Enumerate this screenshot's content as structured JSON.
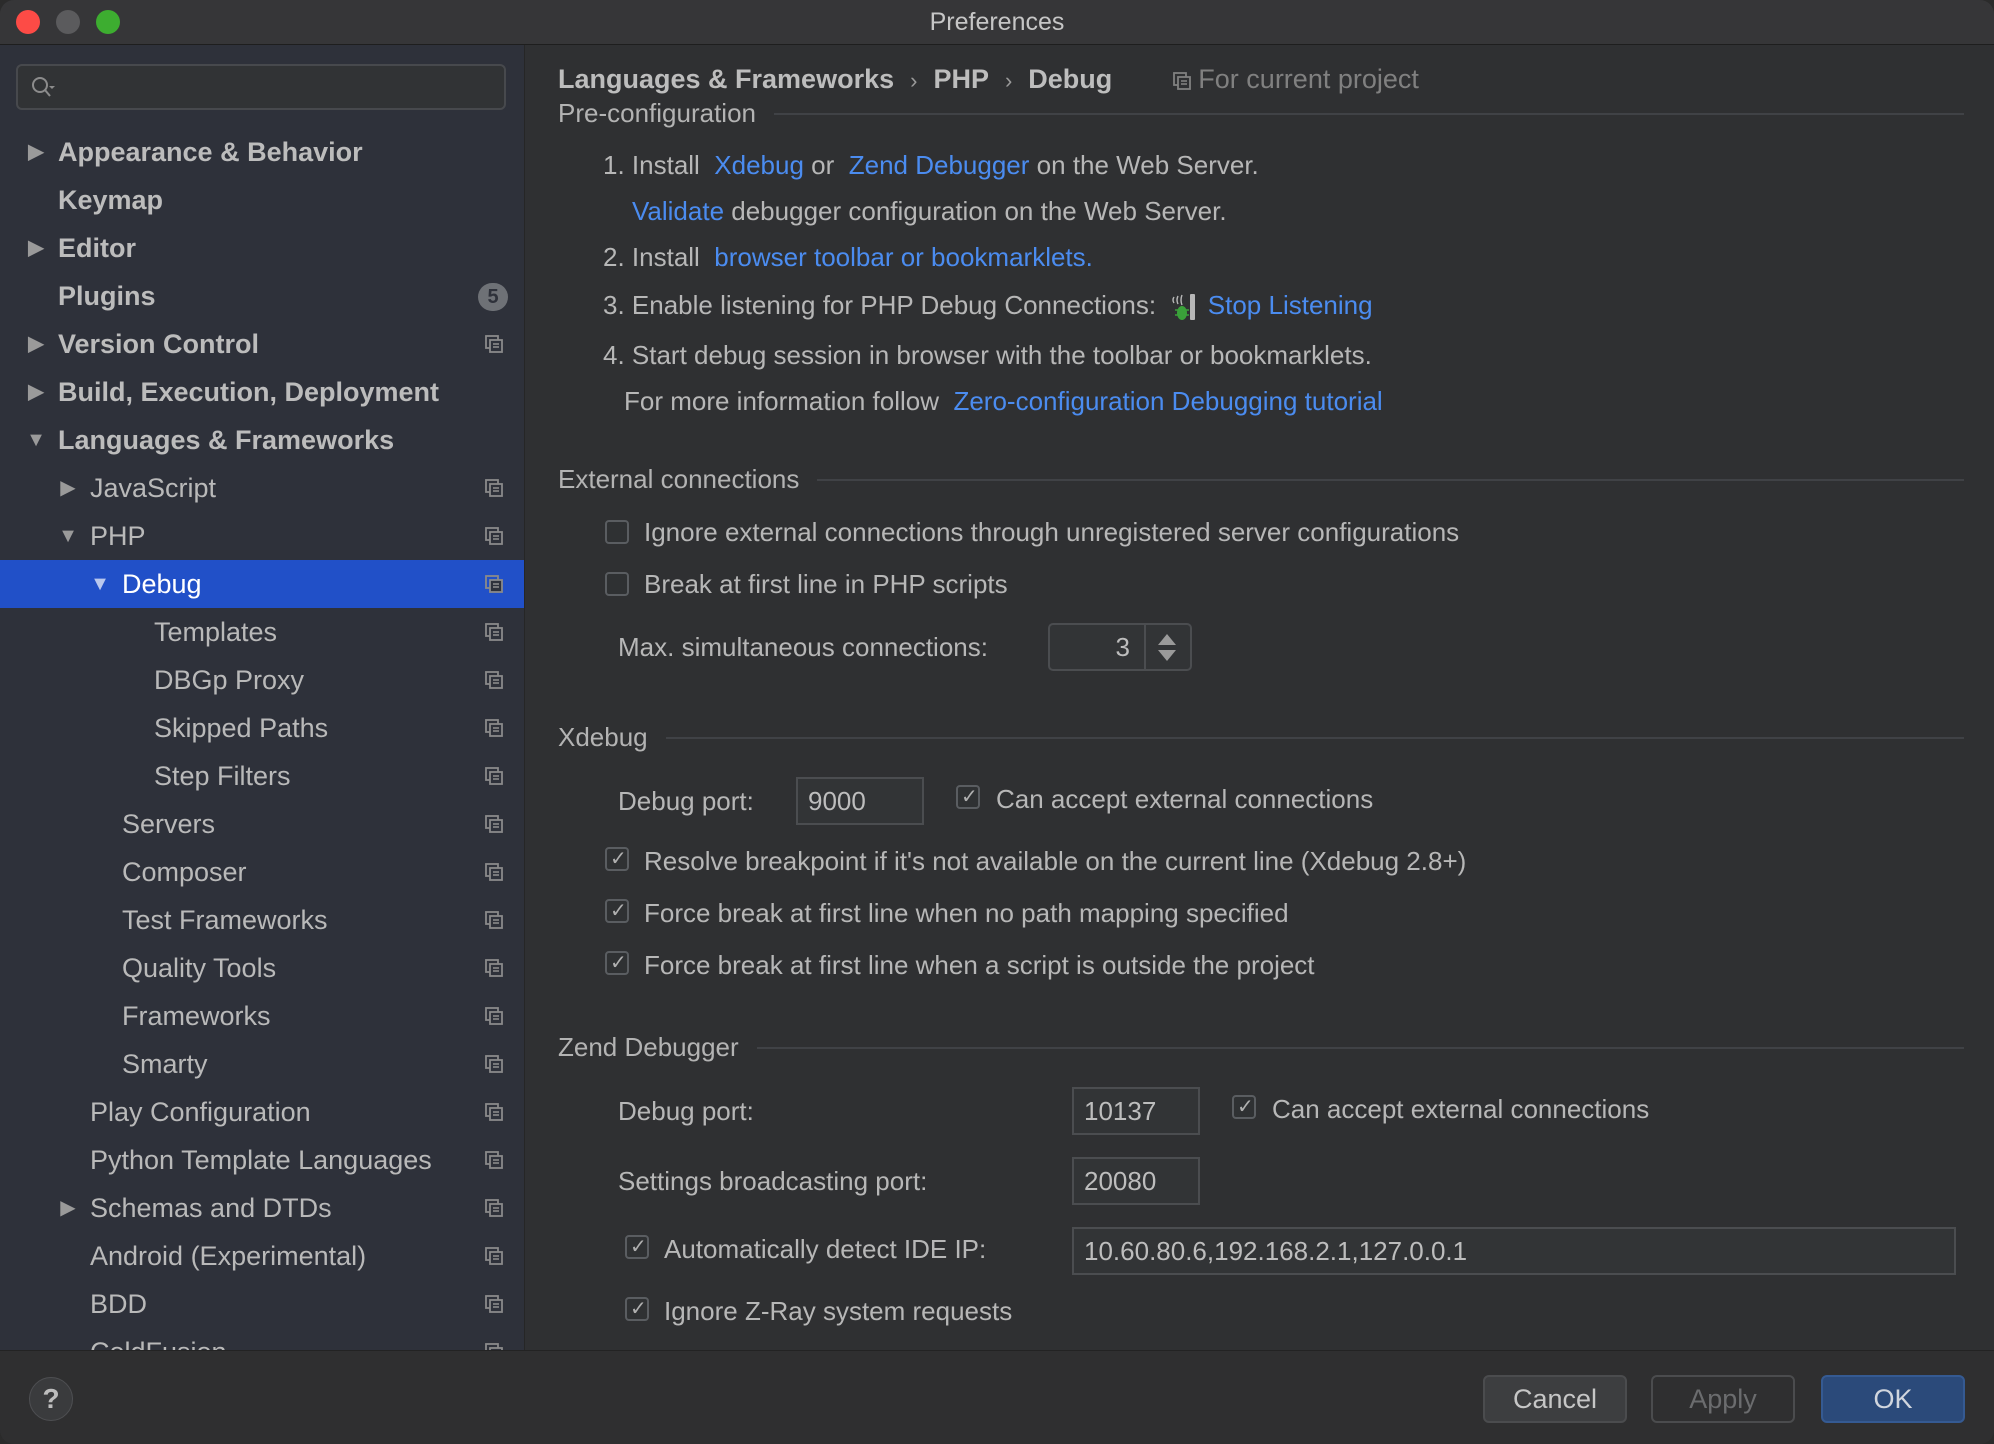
{
  "window": {
    "title": "Preferences"
  },
  "sidebar": {
    "search": {
      "placeholder": "",
      "value": ""
    },
    "items": [
      {
        "label": "Appearance & Behavior",
        "level": 0,
        "bold": true,
        "arrow": "right"
      },
      {
        "label": "Keymap",
        "level": 0,
        "bold": true,
        "arrow": ""
      },
      {
        "label": "Editor",
        "level": 0,
        "bold": true,
        "arrow": "right"
      },
      {
        "label": "Plugins",
        "level": 0,
        "bold": true,
        "arrow": "",
        "badge": "5"
      },
      {
        "label": "Version Control",
        "level": 0,
        "bold": true,
        "arrow": "right",
        "project": true
      },
      {
        "label": "Build, Execution, Deployment",
        "level": 0,
        "bold": true,
        "arrow": "right"
      },
      {
        "label": "Languages & Frameworks",
        "level": 0,
        "bold": true,
        "arrow": "down"
      },
      {
        "label": "JavaScript",
        "level": 1,
        "arrow": "right",
        "project": true
      },
      {
        "label": "PHP",
        "level": 1,
        "arrow": "down",
        "project": true
      },
      {
        "label": "Debug",
        "level": 2,
        "arrow": "down",
        "project": true,
        "selected": true
      },
      {
        "label": "Templates",
        "level": 3,
        "arrow": "",
        "project": true
      },
      {
        "label": "DBGp Proxy",
        "level": 3,
        "arrow": "",
        "project": true
      },
      {
        "label": "Skipped Paths",
        "level": 3,
        "arrow": "",
        "project": true
      },
      {
        "label": "Step Filters",
        "level": 3,
        "arrow": "",
        "project": true
      },
      {
        "label": "Servers",
        "level": 2,
        "arrow": "",
        "project": true
      },
      {
        "label": "Composer",
        "level": 2,
        "arrow": "",
        "project": true
      },
      {
        "label": "Test Frameworks",
        "level": 2,
        "arrow": "",
        "project": true
      },
      {
        "label": "Quality Tools",
        "level": 2,
        "arrow": "",
        "project": true
      },
      {
        "label": "Frameworks",
        "level": 2,
        "arrow": "",
        "project": true
      },
      {
        "label": "Smarty",
        "level": 2,
        "arrow": "",
        "project": true
      },
      {
        "label": "Play Configuration",
        "level": 1,
        "arrow": "",
        "project": true
      },
      {
        "label": "Python Template Languages",
        "level": 1,
        "arrow": "",
        "project": true
      },
      {
        "label": "Schemas and DTDs",
        "level": 1,
        "arrow": "right",
        "project": true
      },
      {
        "label": "Android (Experimental)",
        "level": 1,
        "arrow": "",
        "project": true
      },
      {
        "label": "BDD",
        "level": 1,
        "arrow": "",
        "project": true
      },
      {
        "label": "ColdFusion",
        "level": 1,
        "arrow": "",
        "project": true
      }
    ]
  },
  "breadcrumb": {
    "items": [
      "Languages & Frameworks",
      "PHP",
      "Debug"
    ],
    "separator": "›",
    "scope": "For current project"
  },
  "preconfig": {
    "title": "Pre-configuration",
    "step1_prefix": "1. Install",
    "step1_link1": "Xdebug",
    "step1_or": "or",
    "step1_link2": "Zend Debugger",
    "step1_suffix": "on the Web Server.",
    "validate_link": "Validate",
    "validate_suffix": "debugger configuration on the Web Server.",
    "step2_prefix": "2. Install",
    "step2_link": "browser toolbar or bookmarklets.",
    "step3_prefix": "3. Enable listening for PHP Debug Connections:",
    "step3_link": "Stop Listening",
    "step4": "4. Start debug session in browser with the toolbar or bookmarklets.",
    "more_prefix": "For more information follow",
    "more_link": "Zero-configuration Debugging tutorial"
  },
  "external": {
    "title": "External connections",
    "ignore_label": "Ignore external connections through unregistered server configurations",
    "ignore_checked": false,
    "break_label": "Break at first line in PHP scripts",
    "break_checked": false,
    "max_label": "Max. simultaneous connections:",
    "max_value": "3"
  },
  "xdebug": {
    "title": "Xdebug",
    "port_label": "Debug port:",
    "port_value": "9000",
    "accept_label": "Can accept external connections",
    "accept_checked": true,
    "resolve_label": "Resolve breakpoint if it's not available on the current line (Xdebug 2.8+)",
    "resolve_checked": true,
    "force_nomap_label": "Force break at first line when no path mapping specified",
    "force_nomap_checked": true,
    "force_outside_label": "Force break at first line when a script is outside the project",
    "force_outside_checked": true
  },
  "zend": {
    "title": "Zend Debugger",
    "port_label": "Debug port:",
    "port_value": "10137",
    "accept_label": "Can accept external connections",
    "accept_checked": true,
    "broadcast_label": "Settings broadcasting port:",
    "broadcast_value": "20080",
    "autodetect_label": "Automatically detect IDE IP:",
    "autodetect_checked": true,
    "ip_value": "10.60.80.6,192.168.2.1,127.0.0.1",
    "zray_label": "Ignore Z-Ray system requests",
    "zray_checked": true
  },
  "footer": {
    "help": "?",
    "cancel": "Cancel",
    "apply": "Apply",
    "ok": "OK"
  },
  "colors": {
    "accent": "#2150c8",
    "link": "#4b8cf0",
    "ok_button": "#2b4a7a"
  },
  "icons": {
    "check": "✓",
    "arrow_right": "▶",
    "arrow_down": "▼"
  }
}
